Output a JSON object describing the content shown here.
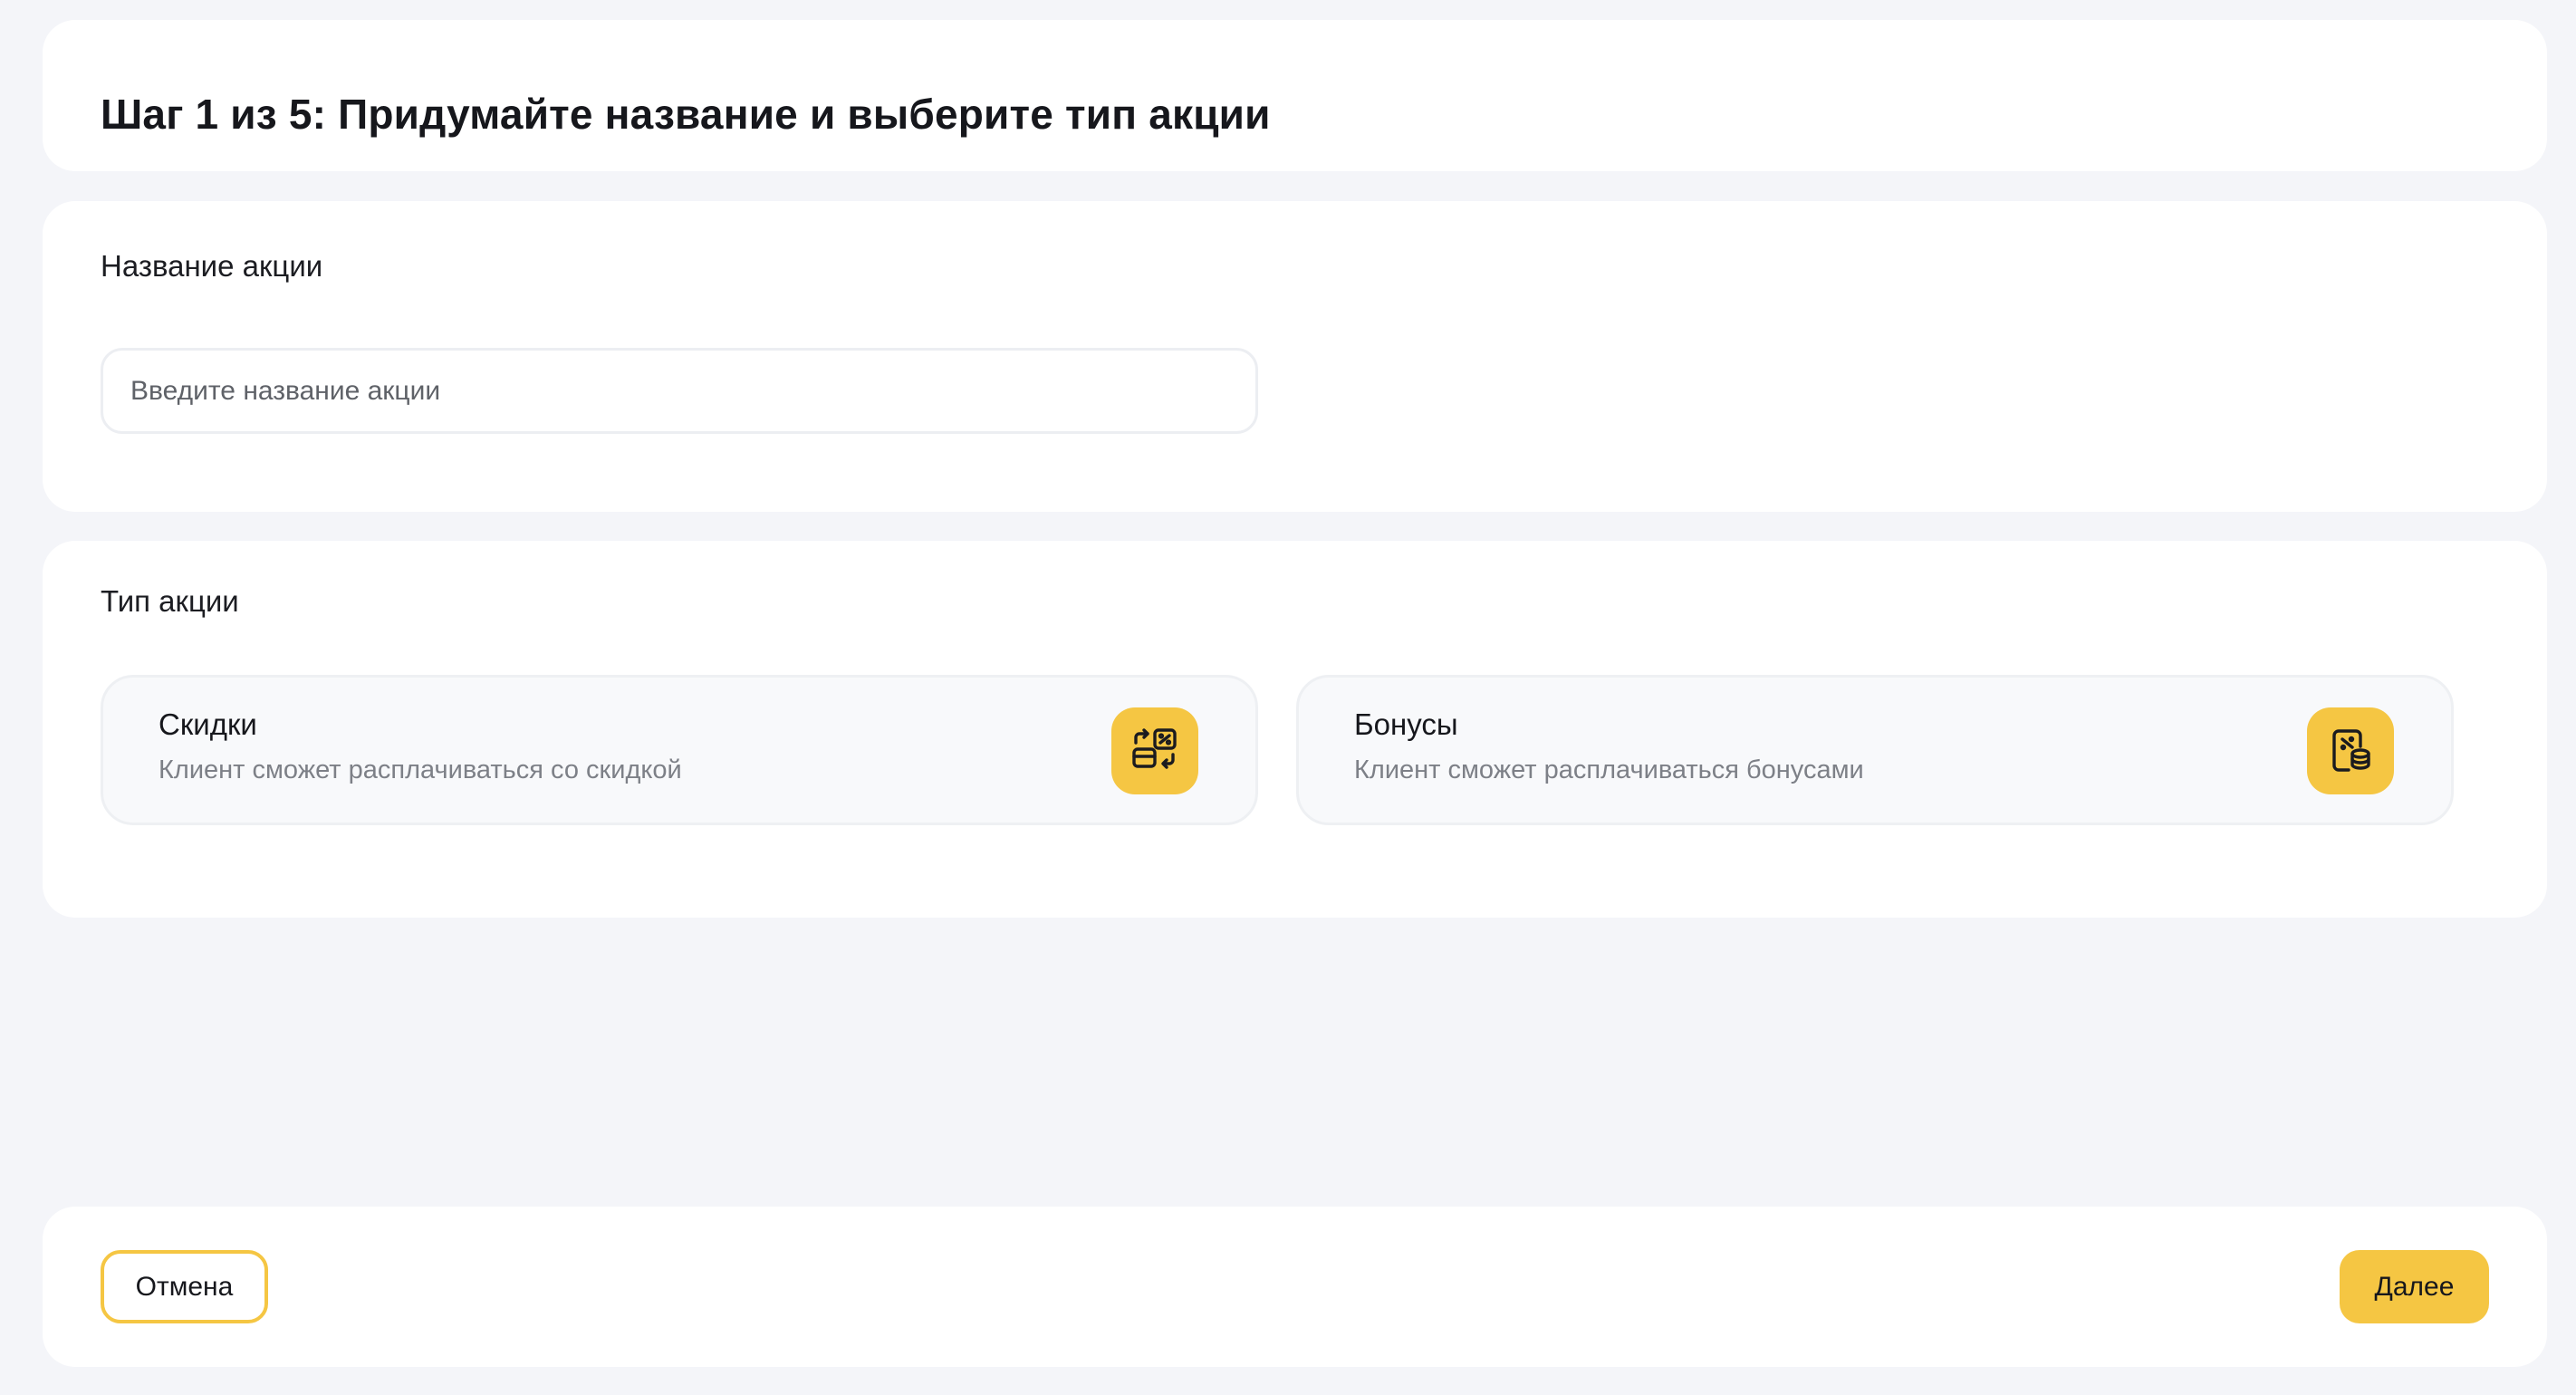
{
  "header": {
    "title": "Шаг 1 из 5: Придумайте название и выберите тип акции"
  },
  "name_section": {
    "label": "Название акции",
    "input_value": "",
    "input_placeholder": "Введите название акции"
  },
  "type_section": {
    "label": "Тип акции",
    "options": [
      {
        "title": "Скидки",
        "description": "Клиент сможет расплачиваться со скидкой",
        "icon": "discount-exchange-icon"
      },
      {
        "title": "Бонусы",
        "description": "Клиент сможет расплачиваться бонусами",
        "icon": "bonus-coins-icon"
      }
    ]
  },
  "footer": {
    "cancel_label": "Отмена",
    "next_label": "Далее"
  },
  "colors": {
    "accent": "#f5c643",
    "background": "#f4f5f9",
    "card": "#ffffff",
    "muted_text": "#7d8087"
  }
}
